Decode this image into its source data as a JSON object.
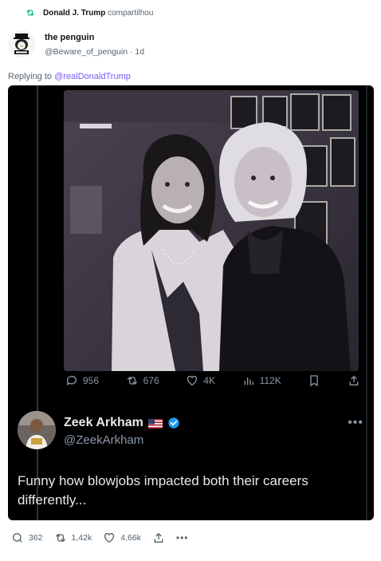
{
  "repost": {
    "text": "compartilhou",
    "name": "Donald J. Trump",
    "icon": "repost-icon"
  },
  "author": {
    "name": "the penguin",
    "handle": "@Beware_of_penguin",
    "age": "1d"
  },
  "reply": {
    "prefix": "Replying to",
    "mention": "@realDonaldTrump"
  },
  "embed": {
    "stats": {
      "replies": "956",
      "reposts": "676",
      "likes": "4K",
      "views": "112K"
    },
    "tweet": {
      "name": "Zeek Arkham",
      "handle": "@ZeekArkham",
      "text": "Funny how blowjobs impacted both their careers differently..."
    }
  },
  "actions": {
    "replies": "362",
    "reposts": "1,42k",
    "likes": "4,66k"
  },
  "colors": {
    "accent": "#7856ff",
    "repost_green": "#00ba7c",
    "verified": "#1d9bf0"
  }
}
